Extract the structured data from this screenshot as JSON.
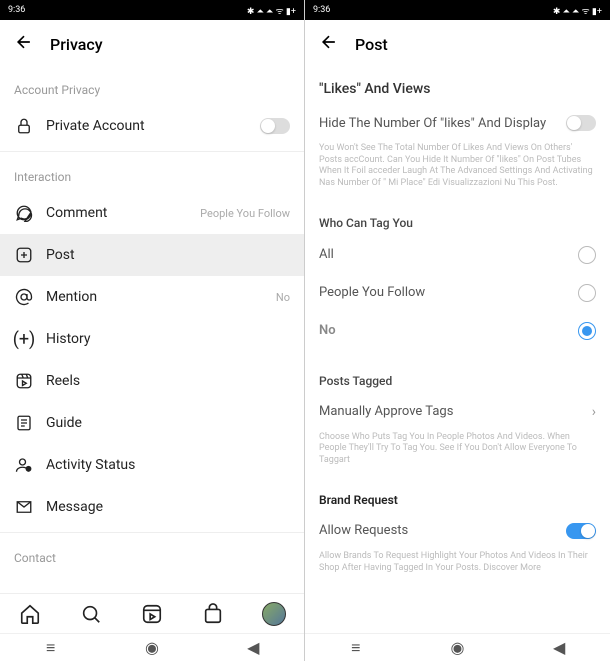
{
  "status": {
    "time": "9:36"
  },
  "left": {
    "title": "Privacy",
    "sections": {
      "account": {
        "label": "Account Privacy",
        "private_account": "Private Account"
      },
      "interaction": {
        "label": "Interaction",
        "comment": "Comment",
        "comment_right": "People You Follow",
        "post": "Post",
        "mention": "Mention",
        "mention_right": "No",
        "history": "History",
        "reels": "Reels",
        "guide": "Guide",
        "activity_status": "Activity Status",
        "message": "Message"
      },
      "contact": {
        "label": "Contact"
      }
    }
  },
  "right": {
    "title": "Post",
    "likes_section": {
      "title": "\"Likes\" And Views",
      "hide_label": "Hide The Number Of \"likes\" And Display",
      "help_text": "You Won't See The Total Number Of Likes And Views On Others' Posts accCount. Can You Hide It Number Of \"likes\" On Post Tubes When It Foil acceder Laugh At The Advanced Settings And Activating Nas Number Of \" Mi Place\" Edi Visualizzazioni Nu This Post."
    },
    "tag_section": {
      "title": "Who Can Tag You",
      "all": "All",
      "people_follow": "People You Follow",
      "no": "No"
    },
    "tagged_section": {
      "title": "Posts Tagged",
      "manual": "Manually Approve Tags",
      "help_text": "Choose Who Puts Tag You In People Photos And Videos. When People They'll Try To Tag You. See If You Don't Allow Everyone To Taggart"
    },
    "brand_section": {
      "title": "Brand Request",
      "allow": "Allow Requests",
      "help_text": "Allow Brands To Request Highlight Your Photos And Videos In Their Shop After Having Tagged In Your Posts. Discover More"
    }
  }
}
